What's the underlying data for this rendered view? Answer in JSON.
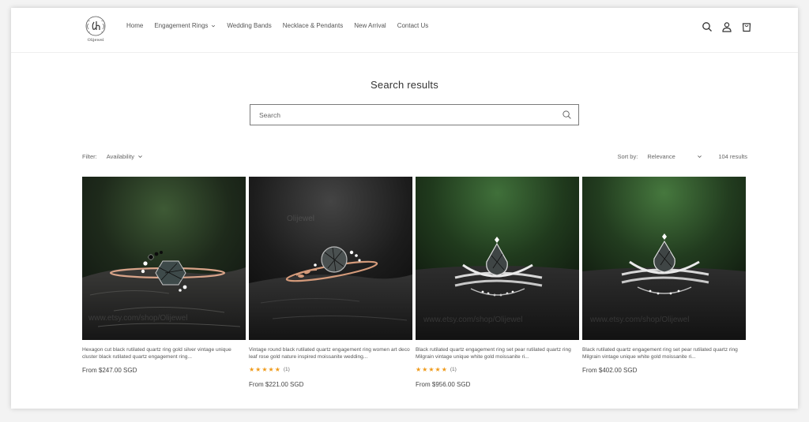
{
  "header": {
    "logo_text": "Olijewel",
    "nav": [
      "Home",
      "Engagement Rings",
      "Wedding Bands",
      "Necklace & Pendants",
      "New Arrival",
      "Contact Us"
    ]
  },
  "page_title": "Search results",
  "search": {
    "placeholder": "Search"
  },
  "filter": {
    "label": "Filter:",
    "availability": "Availability"
  },
  "sort": {
    "label": "Sort by:",
    "value": "Relevance",
    "count": "104 results"
  },
  "products": [
    {
      "title": "Hexagon cut black rutilated quartz ring gold silver vintage unique cluster black rutilated quartz engagement ring...",
      "rating": "★★★★★",
      "reviews": "",
      "price": "From $247.00 SGD",
      "watermark": "www.etsy.com/shop/Olijewel"
    },
    {
      "title": "Vintage round black rutilated quartz engagement ring women art deco leaf rose gold nature inspired moissanite wedding...",
      "rating": "★★★★★",
      "reviews": "(1)",
      "price": "From $221.00 SGD",
      "watermark": "Olijewel"
    },
    {
      "title": "Black rutilated quartz engagement ring set pear rutilated quartz ring Milgrain vintage unique white gold moissanite ri...",
      "rating": "★★★★★",
      "reviews": "(1)",
      "price": "From $956.00 SGD",
      "watermark": "www.etsy.com/shop/Olijewel"
    },
    {
      "title": "Black rutilated quartz engagement ring set pear rutilated quartz ring Milgrain vintage unique white gold moissanite ri...",
      "rating": "",
      "reviews": "",
      "price": "From $402.00 SGD",
      "watermark": "www.etsy.com/shop/Olijewel"
    }
  ],
  "colors": {
    "star": "#ef9a1a",
    "border": "#7b7b7b",
    "background": "#ffffff"
  },
  "icons": [
    "search-icon",
    "account-icon",
    "cart-icon",
    "chevron-down-icon"
  ]
}
